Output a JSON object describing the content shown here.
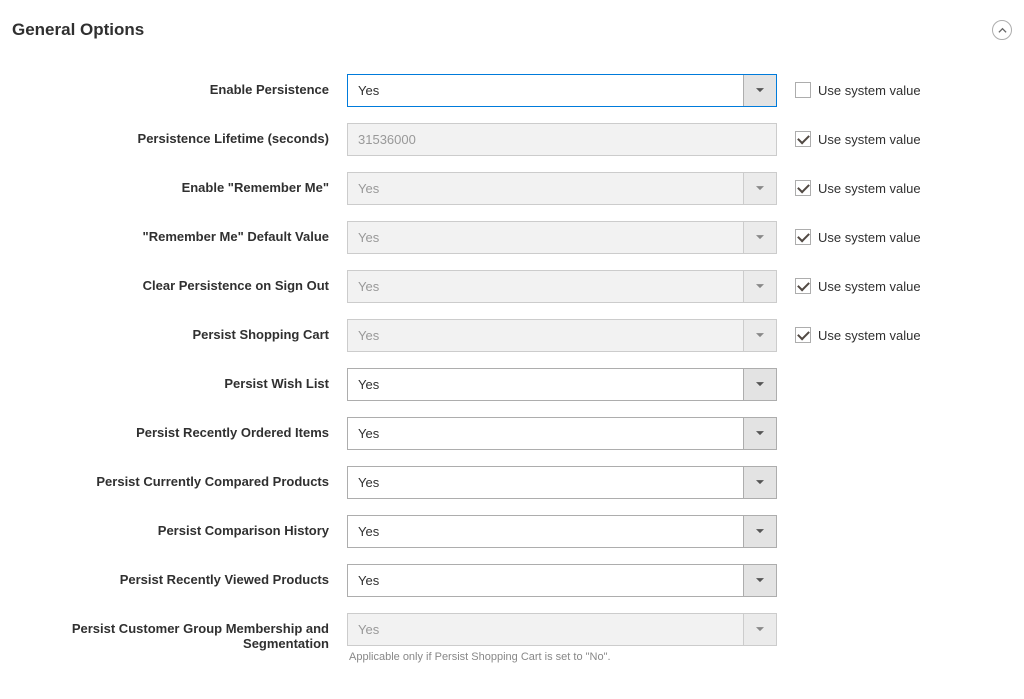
{
  "section": {
    "title": "General Options"
  },
  "labels": {
    "use_system_value": "Use system value"
  },
  "fields": {
    "enable_persistence": {
      "label": "Enable Persistence",
      "value": "Yes"
    },
    "persistence_lifetime": {
      "label": "Persistence Lifetime (seconds)",
      "value": "31536000"
    },
    "enable_remember_me": {
      "label": "Enable \"Remember Me\"",
      "value": "Yes"
    },
    "remember_me_default": {
      "label": "\"Remember Me\" Default Value",
      "value": "Yes"
    },
    "clear_on_sign_out": {
      "label": "Clear Persistence on Sign Out",
      "value": "Yes"
    },
    "persist_shopping_cart": {
      "label": "Persist Shopping Cart",
      "value": "Yes"
    },
    "persist_wish_list": {
      "label": "Persist Wish List",
      "value": "Yes"
    },
    "persist_recently_ordered": {
      "label": "Persist Recently Ordered Items",
      "value": "Yes"
    },
    "persist_currently_compared": {
      "label": "Persist Currently Compared Products",
      "value": "Yes"
    },
    "persist_comparison_history": {
      "label": "Persist Comparison History",
      "value": "Yes"
    },
    "persist_recently_viewed": {
      "label": "Persist Recently Viewed Products",
      "value": "Yes"
    },
    "persist_customer_group": {
      "label": "Persist Customer Group Membership and Segmentation",
      "value": "Yes",
      "note": "Applicable only if Persist Shopping Cart is set to \"No\"."
    }
  }
}
